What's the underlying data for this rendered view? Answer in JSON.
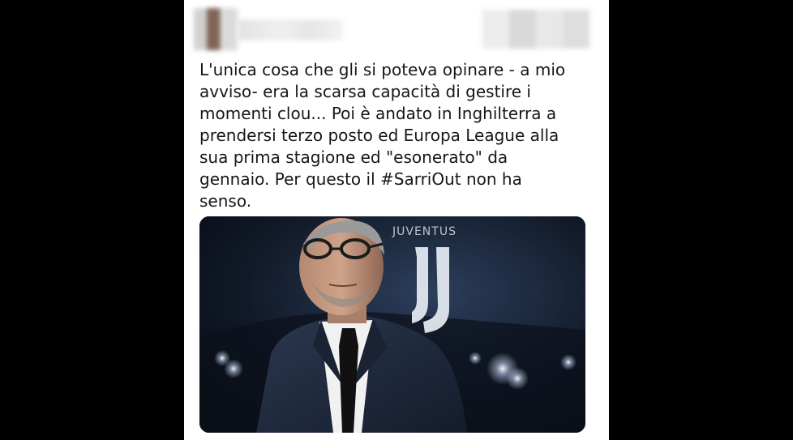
{
  "tweet": {
    "author": {
      "avatar_icon": "user-avatar-icon",
      "redacted": true
    },
    "text": "L'unica cosa che gli si poteva opinare - a mio\navviso- era la scarsa capacità di gestire i\nmomenti clou... Poi è andato in Inghilterra a\nprendersi terzo posto ed Europa League alla\nsua prima stagione ed \"esonerato\" da\ngennaio. Per questo il #SarriOut non ha\nsenso.",
    "media": {
      "logo_text": "JUVENTUS",
      "colors": {
        "background_dark": "#0c1420",
        "stadium_light": "#dfe8f5",
        "suit": "#1f2a3d",
        "tie": "#111111",
        "shirt": "#f4f4f4"
      }
    }
  }
}
